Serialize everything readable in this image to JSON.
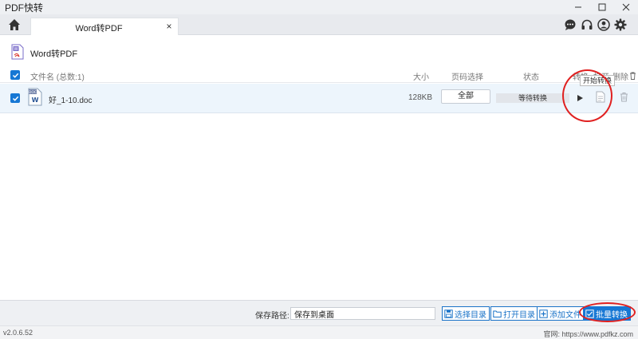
{
  "app": {
    "title": "PDF快转"
  },
  "tab": {
    "label": "Word转PDF",
    "close": "×"
  },
  "feature": {
    "title": "Word转PDF"
  },
  "list_header": {
    "filename": "文件名 (总数:1)",
    "size": "大小",
    "page_select": "页码选择",
    "status": "状态",
    "convert": "转换",
    "open": "打开",
    "delete": "删除"
  },
  "rows": [
    {
      "name": "好_1-10.doc",
      "size": "128KB",
      "pages": "全部",
      "status": "等待转换",
      "checked": true
    }
  ],
  "tooltip": "开始转换",
  "bottom": {
    "save_label": "保存路径:",
    "save_value": "保存到桌面",
    "choose_dir": "选择目录",
    "open_dir": "打开目录",
    "add_file": "添加文件",
    "batch_convert": "批量转换"
  },
  "footer": {
    "version": "v2.0.6.52",
    "website": "官网: https://www.pdfkz.com"
  },
  "colors": {
    "accent": "#1677d4",
    "annotation": "#e02020",
    "row_bg": "#edf5fc"
  },
  "icons": [
    "home-icon",
    "chat-icon",
    "headset-icon",
    "user-icon",
    "gear-icon",
    "word-file-icon",
    "play-icon",
    "document-icon",
    "trash-icon"
  ]
}
